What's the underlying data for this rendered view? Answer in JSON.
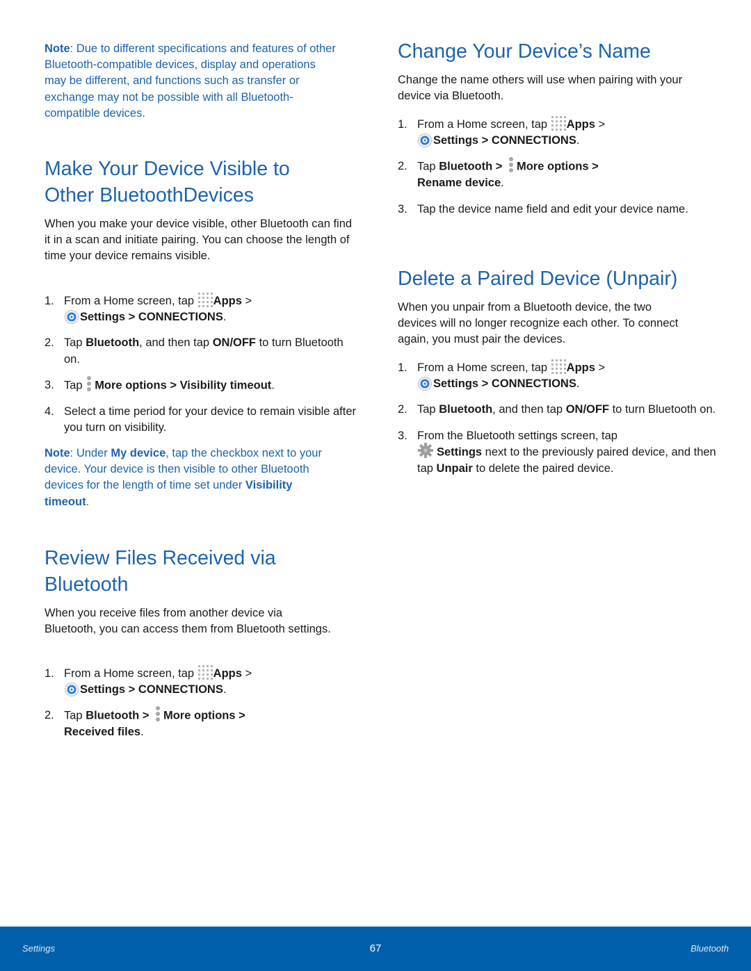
{
  "colors": {
    "accent": "#1c63ad",
    "footer_bg": "#0160ab"
  },
  "icons": {
    "apps": "apps-grid-icon",
    "settings": "settings-gear-blue-icon",
    "more": "more-options-vertical-dots-icon",
    "gear": "settings-gear-gray-icon"
  },
  "left": {
    "note": {
      "label": "Note",
      "text": ": Due to different specifications and features of other Bluetooth-compatible devices, display and operations may be different, and functions such as transfer or exchange may not be possible with all Bluetooth-compatible devices."
    },
    "visible": {
      "title": "Make Your Device Visible to Other BluetoothDevices",
      "intro": "When you make your device visible, other Bluetooth can find it in a scan and initiate pairing. You can choose the length of time your device remains visible.",
      "steps": {
        "s1": {
          "num": "1.",
          "pre": "From a Home screen, tap ",
          "apps": "Apps",
          "sep1": " > ",
          "settings": "Settings",
          "sep2": " > ",
          "connections": "CONNECTIONS",
          "end": "."
        },
        "s2": {
          "num": "2.",
          "pre": "Tap ",
          "b1": "Bluetooth",
          "mid": ", and then tap ",
          "b2": "ON/OFF",
          "end": " to turn Bluetooth on."
        },
        "s3": {
          "num": "3.",
          "pre": "Tap ",
          "b1": "More options",
          "sep": " > ",
          "b2": "Visibility timeout",
          "end": "."
        },
        "s4": {
          "num": "4.",
          "text": "Select a time period for your device to remain visible after you turn on visibility."
        }
      },
      "note": {
        "label": "Note",
        "t1": ": Under ",
        "b1": "My device",
        "t2": ", tap the checkbox next to your device. Your device is then visible to other Bluetooth devices for the length of time set under ",
        "b2": "Visibility timeout",
        "t3": "."
      }
    },
    "review": {
      "title": "Review Files Received via Bluetooth",
      "intro": "When you receive files from another device via Bluetooth, you can access them from Bluetooth settings.",
      "steps": {
        "s1": {
          "num": "1.",
          "pre": "From a Home screen, tap ",
          "apps": "Apps",
          "sep1": " > ",
          "settings": "Settings",
          "sep2": " > ",
          "connections": "CONNECTIONS",
          "end": "."
        },
        "s2": {
          "num": "2.",
          "pre": "Tap ",
          "b1": "Bluetooth",
          "sep1": " > ",
          "b2": "More options",
          "sep2": " > ",
          "b3": "Received files",
          "end": "."
        }
      }
    }
  },
  "right": {
    "rename": {
      "title": "Change Your Device’s Name",
      "intro": "Change the name others will use when pairing with your device via Bluetooth.",
      "steps": {
        "s1": {
          "num": "1.",
          "pre": "From a Home screen, tap ",
          "apps": "Apps",
          "sep1": " > ",
          "settings": "Settings",
          "sep2": " > ",
          "connections": "CONNECTIONS",
          "end": "."
        },
        "s2": {
          "num": "2.",
          "pre": "Tap ",
          "b1": "Bluetooth",
          "sep1": " > ",
          "b2": "More options",
          "sep2": " > ",
          "b3": "Rename device",
          "end": "."
        },
        "s3": {
          "num": "3.",
          "text": "Tap the device name field and edit your device name."
        }
      }
    },
    "unpair": {
      "title": "Delete a Paired Device (Unpair)",
      "intro": "When you unpair from a Bluetooth device, the two devices will no longer recognize each other. To connect again, you must pair the devices.",
      "steps": {
        "s1": {
          "num": "1.",
          "pre": "From a Home screen, tap ",
          "apps": "Apps",
          "sep1": " > ",
          "settings": "Settings",
          "sep2": " > ",
          "connections": "CONNECTIONS",
          "end": "."
        },
        "s2": {
          "num": "2.",
          "pre": "Tap ",
          "b1": "Bluetooth",
          "mid": ", and then tap ",
          "b2": "ON/OFF",
          "end": " to turn Bluetooth on."
        },
        "s3": {
          "num": "3.",
          "pre": "From the Bluetooth settings screen, tap ",
          "b1": "Settings",
          "mid": " next to the previously paired device, and then tap ",
          "b2": "Unpair",
          "end": " to delete the paired device."
        }
      }
    }
  },
  "footer": {
    "left": "Settings",
    "page": "67",
    "right": "Bluetooth"
  }
}
